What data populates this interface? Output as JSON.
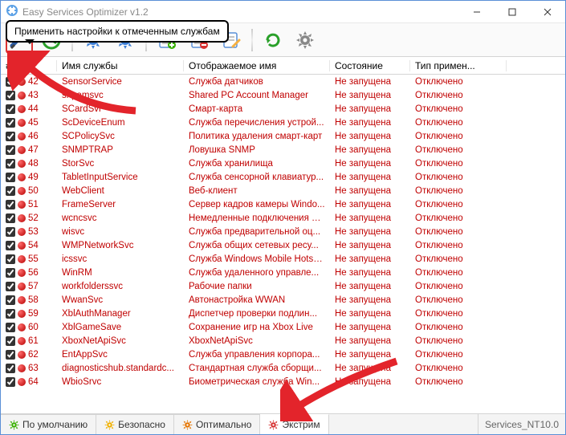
{
  "title": "Easy Services Optimizer v1.2",
  "tooltip": "Применить настройки к отмеченным службам",
  "columns": {
    "idx": "#",
    "name": "Имя службы",
    "display": "Отображаемое имя",
    "state": "Состояние",
    "apply": "Тип примен..."
  },
  "state_text": "Не запущена",
  "apply_text": "Отключено",
  "rows": [
    {
      "n": 42,
      "name": "SensorService",
      "display": "Служба датчиков"
    },
    {
      "n": 43,
      "name": "shpamsvc",
      "display": "Shared PC Account Manager"
    },
    {
      "n": 44,
      "name": "SCardSvr",
      "display": "Смарт-карта"
    },
    {
      "n": 45,
      "name": "ScDeviceEnum",
      "display": "Служба перечисления устрой..."
    },
    {
      "n": 46,
      "name": "SCPolicySvc",
      "display": "Политика удаления смарт-карт"
    },
    {
      "n": 47,
      "name": "SNMPTRAP",
      "display": "Ловушка SNMP"
    },
    {
      "n": 48,
      "name": "StorSvc",
      "display": "Служба хранилища"
    },
    {
      "n": 49,
      "name": "TabletInputService",
      "display": "Служба сенсорной клавиатур..."
    },
    {
      "n": 50,
      "name": "WebClient",
      "display": "Веб-клиент"
    },
    {
      "n": 51,
      "name": "FrameServer",
      "display": "Сервер кадров камеры Windo..."
    },
    {
      "n": 52,
      "name": "wcncsvc",
      "display": "Немедленные подключения W..."
    },
    {
      "n": 53,
      "name": "wisvc",
      "display": "Служба предварительной оц..."
    },
    {
      "n": 54,
      "name": "WMPNetworkSvc",
      "display": "Служба общих сетевых ресу..."
    },
    {
      "n": 55,
      "name": "icssvc",
      "display": "Служба Windows Mobile Hotspot"
    },
    {
      "n": 56,
      "name": "WinRM",
      "display": "Служба удаленного управле..."
    },
    {
      "n": 57,
      "name": "workfolderssvc",
      "display": "Рабочие папки"
    },
    {
      "n": 58,
      "name": "WwanSvc",
      "display": "Автонастройка WWAN"
    },
    {
      "n": 59,
      "name": "XblAuthManager",
      "display": "Диспетчер проверки подлин..."
    },
    {
      "n": 60,
      "name": "XblGameSave",
      "display": "Сохранение игр на Xbox Live"
    },
    {
      "n": 61,
      "name": "XboxNetApiSvc",
      "display": "XboxNetApiSvc"
    },
    {
      "n": 62,
      "name": "EntAppSvc",
      "display": "Служба управления корпора..."
    },
    {
      "n": 63,
      "name": "diagnosticshub.standardc...",
      "display": "Стандартная служба сборщи..."
    },
    {
      "n": 64,
      "name": "WbioSrvc",
      "display": "Биометрическая служба Win..."
    }
  ],
  "tabs": {
    "default": "По умолчанию",
    "safe": "Безопасно",
    "optimal": "Оптимально",
    "extreme": "Экстрим"
  },
  "status_right": "Services_NT10.0",
  "colors": {
    "accent_red": "#c00000",
    "arrow_red": "#e3242b"
  }
}
